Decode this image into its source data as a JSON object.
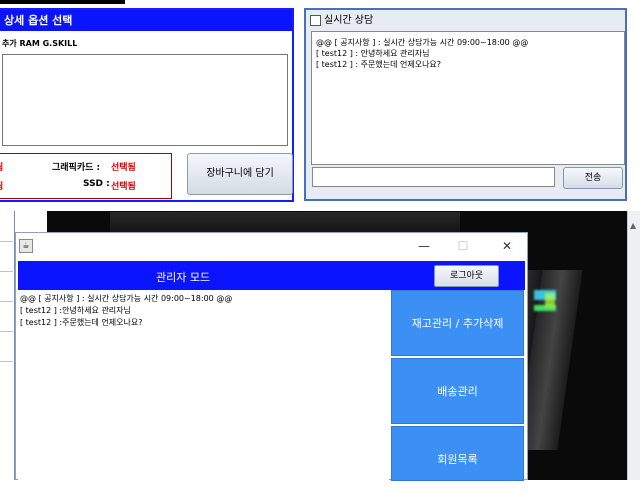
{
  "options_panel": {
    "title": "상세 옵션 선택",
    "ram_line": "추가 RAM G.SKILL",
    "selections": [
      {
        "label": "",
        "value": "됨"
      },
      {
        "label": "그래픽카드 :",
        "value": "선택됨"
      },
      {
        "label": "",
        "value": "됨"
      },
      {
        "label": "SSD :",
        "value": "선택됨"
      }
    ],
    "cart_button": "장바구니에 담기"
  },
  "chat_window": {
    "title": "실시간 상담",
    "messages": [
      "@@ [ 공지사항 ] : 실시간 상담가능 시간 09:00~18:00 @@",
      "[ test12 ] : 안녕하세요 관리자님",
      "[ test12 ] : 주문했는데 언제오나요?"
    ],
    "send_button": "전송"
  },
  "admin_window": {
    "title": "관리자 모드",
    "logout_button": "로그아웃",
    "messages": [
      "@@ [ 공지사항 ] : 실시간 상담가능 시간 09:00~18:00 @@",
      "[ test12 ] :안녕하세요 관리자님",
      "[ test12 ] :주문했는데 언제오나요?"
    ],
    "menu": [
      {
        "label": "재고관리 / 추가삭제"
      },
      {
        "label": "배송관리"
      },
      {
        "label": "회원목록"
      }
    ],
    "window_controls": {
      "minimize": "—",
      "maximize": "☐",
      "close": "✕"
    }
  }
}
